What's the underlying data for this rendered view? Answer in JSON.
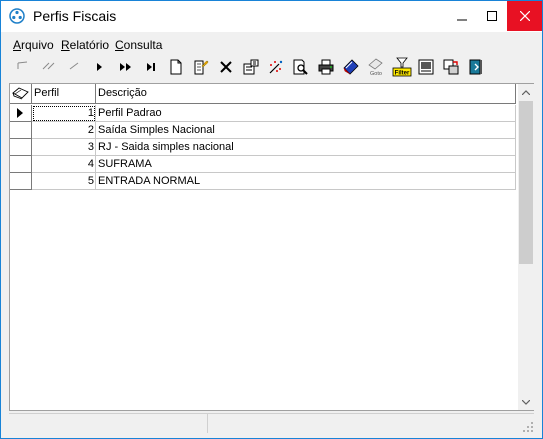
{
  "window": {
    "title": "Perfis Fiscais",
    "accent": "#1883d7",
    "close_color": "#e81123"
  },
  "menu": {
    "items": [
      {
        "pre": "",
        "u": "A",
        "post": "rquivo"
      },
      {
        "pre": "",
        "u": "R",
        "post": "elatório"
      },
      {
        "pre": "",
        "u": "C",
        "post": "onsulta"
      }
    ]
  },
  "toolbar": {
    "buttons": [
      "first-record",
      "prior-page",
      "prior-record",
      "next-record",
      "next-page",
      "last-record",
      "new-record",
      "edit-record",
      "delete-record",
      "properties",
      "clear-filter",
      "find",
      "preview",
      "print",
      "blue-tag",
      "goto",
      "filter",
      "report-view",
      "export",
      "exit"
    ],
    "goto_label": "Goto",
    "filter_label": "Filter"
  },
  "grid": {
    "columns": {
      "perfil": "Perfil",
      "descricao": "Descrição"
    },
    "rows": [
      {
        "perfil": "1",
        "descricao": "Perfil Padrao"
      },
      {
        "perfil": "2",
        "descricao": "Saída Simples Nacional"
      },
      {
        "perfil": "3",
        "descricao": "RJ - Saida simples nacional"
      },
      {
        "perfil": "4",
        "descricao": "SUFRAMA"
      },
      {
        "perfil": "5",
        "descricao": "ENTRADA NORMAL"
      }
    ],
    "current_row": 1
  }
}
